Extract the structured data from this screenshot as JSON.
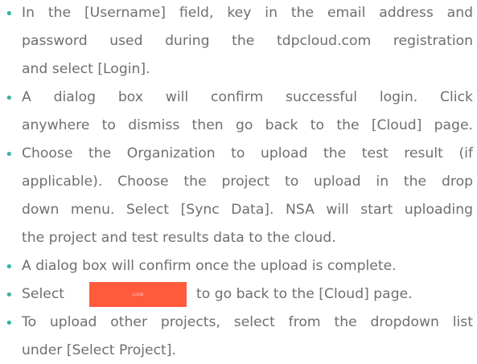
{
  "accent_color": "#36b5a4",
  "button_color": "#ff5a3c",
  "steps": [
    {
      "lines": [
        "In the [Username] field, key in the email address and",
        "password used during the tdpcloud.com registration",
        "and select [Login]."
      ]
    },
    {
      "lines": [
        "A dialog box will confirm successful login. Click",
        "anywhere to dismiss then go back to the [Cloud] page."
      ]
    },
    {
      "lines": [
        "Choose the Organization to upload the test result (if",
        "applicable). Choose the project to upload in the drop",
        "down menu. Select [Sync Data]. NSA will start uploading",
        "the project and test results data to the cloud."
      ]
    },
    {
      "lines": [
        "A dialog box will confirm once the upload is complete."
      ]
    },
    {
      "before_button": "Select",
      "button_label": "CLOSE",
      "after_button": "to go back to the [Cloud] page."
    },
    {
      "lines": [
        "To upload other projects, select from the dropdown list",
        "under [Select Project]."
      ]
    }
  ]
}
